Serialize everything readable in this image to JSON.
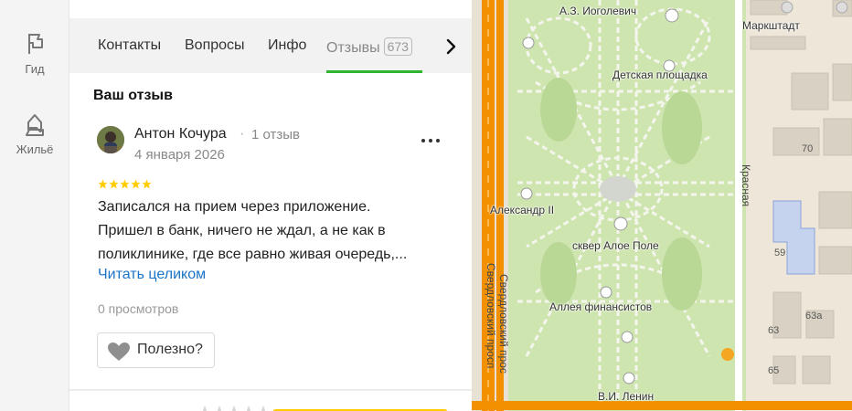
{
  "rail": {
    "items": [
      {
        "label": "Гид",
        "icon": "flag-icon"
      },
      {
        "label": "Жильё",
        "icon": "house-hand-icon"
      }
    ]
  },
  "tabs": {
    "items": [
      "Контакты",
      "Вопросы",
      "Инфо"
    ],
    "active_label": "Отзывы",
    "active_count": "673"
  },
  "review": {
    "section_title": "Ваш отзыв",
    "author_name": "Антон Кочура",
    "separator": "·",
    "author_reviews": "1 отзыв",
    "date": "4 января 2026",
    "rating": 5,
    "text_lines": [
      "Записался на прием через приложение.",
      "Пришел в банк, ничего не ждал, а не как в",
      "поликлинике, где все равно живая очередь,..."
    ],
    "read_more": "Читать целиком",
    "views": "0 просмотров",
    "helpful_label": "Полезно?"
  },
  "map": {
    "labels": {
      "monument_iogolevich": "А.З. Иоголевич",
      "playground": "Детская площадка",
      "alexander": "Александр II",
      "square": "сквер Алое Поле",
      "alley": "Аллея финансистов",
      "lenin": "В.И. Ленин",
      "markshtadt": "Маркштадт"
    },
    "streets": {
      "sverdlovsky_1": "Свердловский просп",
      "sverdlovsky_2": "Свердловский прос",
      "krasnaya": "Красная"
    },
    "house_numbers": [
      "70",
      "59",
      "63а",
      "63",
      "65"
    ]
  },
  "colors": {
    "accent_green": "#2fb52f",
    "link_blue": "#1a73c7",
    "star_yellow": "#ffcc00",
    "map_park": "#d5e8b8",
    "map_road": "#f29000"
  }
}
